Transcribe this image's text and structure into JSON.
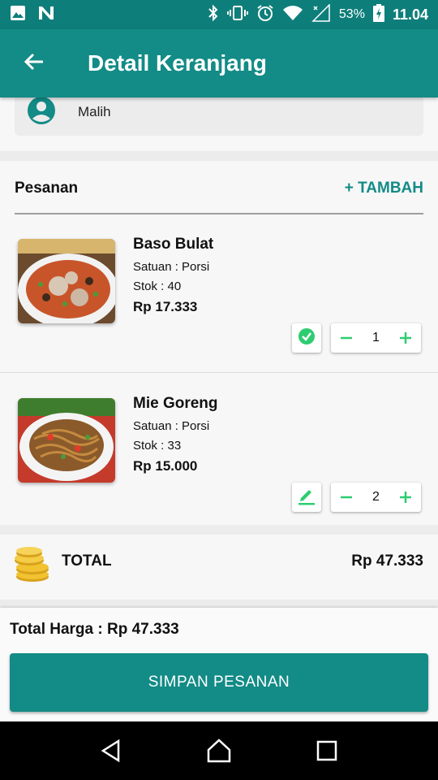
{
  "status_bar": {
    "battery": "53%",
    "time": "11.04",
    "icons": [
      "image-icon",
      "n-notification-icon",
      "bluetooth-icon",
      "vibrate-icon",
      "alarm-icon",
      "wifi-icon",
      "signal-icon",
      "battery-icon"
    ]
  },
  "app_bar": {
    "title": "Detail Keranjang",
    "back_icon": "arrow-back-icon"
  },
  "customer": {
    "name": "Malih",
    "icon": "account-circle-icon"
  },
  "orders": {
    "title": "Pesanan",
    "add_label": "+ TAMBAH",
    "items": [
      {
        "name": "Baso Bulat",
        "unit": "Satuan : Porsi",
        "stock": "Stok : 40",
        "price": "Rp 17.333",
        "quantity": "1",
        "action_icon": "check-circle-icon"
      },
      {
        "name": "Mie Goreng",
        "unit": "Satuan : Porsi",
        "stock": "Stok : 33",
        "price": "Rp 15.000",
        "quantity": "2",
        "action_icon": "edit-pencil-icon"
      }
    ]
  },
  "total": {
    "label": "TOTAL",
    "value": "Rp 47.333",
    "icon": "coins-icon"
  },
  "footer": {
    "total_harga": "Total Harga : Rp 47.333",
    "save_label": "SIMPAN PESANAN"
  },
  "colors": {
    "primary": "#138b86",
    "status_bar": "#0e7e7a",
    "accent_green": "#2ecc71"
  }
}
